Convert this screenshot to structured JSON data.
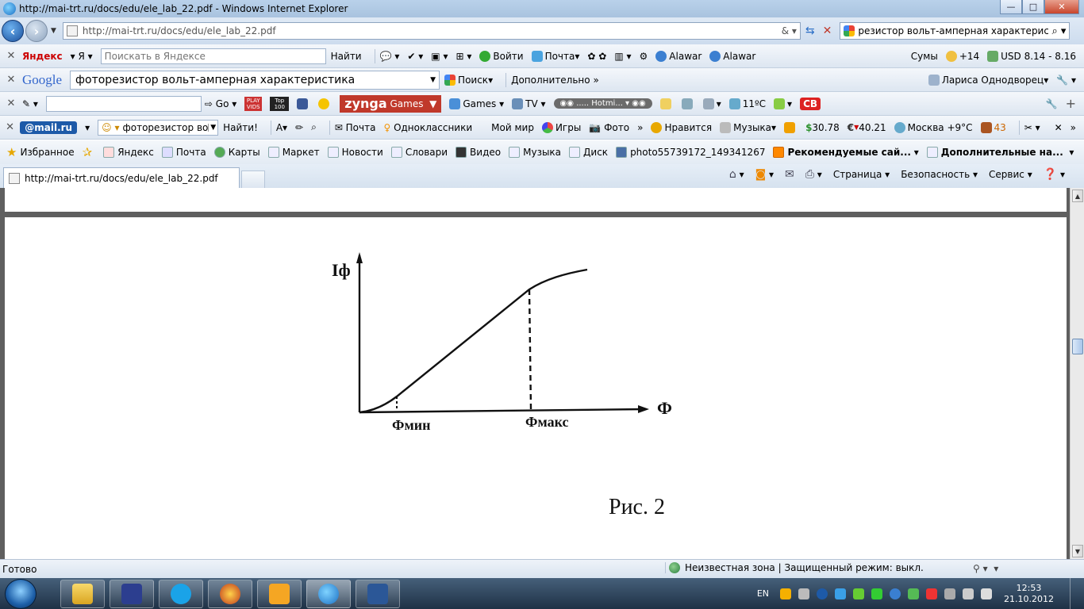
{
  "window": {
    "title": "http://mai-trt.ru/docs/edu/ele_lab_22.pdf - Windows Internet Explorer",
    "minimize": "—",
    "maximize": "□",
    "close": "✕"
  },
  "address_bar": {
    "url": "http://mai-trt.ru/docs/edu/ele_lab_22.pdf",
    "search_value": "резистор вольт-амперная характеристика"
  },
  "yandex_bar": {
    "brand": "Яндекс",
    "search_placeholder": "Поискать в Яндексе",
    "find": "Найти",
    "login": "Войти",
    "mail": "Почта",
    "alawar1": "Alawar",
    "alawar2": "Alawar",
    "sums": "Сумы",
    "temp": "+14",
    "usd": "USD 8.14 - 8.16"
  },
  "google_bar": {
    "brand": "Google",
    "query": "фоторезистор вольт-амперная характеристика",
    "search": "Поиск",
    "more": "Дополнительно",
    "user": "Лариса Однодворец"
  },
  "toolbar3": {
    "go": "Go",
    "games_brand": "zynga",
    "games": "Games",
    "games2": "Games",
    "tv": "TV",
    "hotmail": "..... Hotmi...",
    "weather": "11ºC",
    "cb": "CB",
    "play": "PLAY VIDS",
    "top": "Top 100"
  },
  "mail_bar": {
    "brand": "@mail.ru",
    "query": "фоторезистор вольт",
    "find": "Найти!",
    "mail": "Почта",
    "ok": "Одноклассники",
    "myworld": "Мой мир",
    "games": "Игры",
    "photo": "Фото",
    "like": "Нравится",
    "music": "Музыка",
    "usd": "30.78",
    "eur": "40.21",
    "weather": "Москва +9°С",
    "count": "43"
  },
  "favorites": {
    "label": "Избранное",
    "items": [
      "Яндекс",
      "Почта",
      "Карты",
      "Маркет",
      "Новости",
      "Словари",
      "Видео",
      "Музыка",
      "Диск",
      "photo55739172_149341267"
    ],
    "recommended": "Рекомендуемые сай...",
    "additional": "Дополнительные на..."
  },
  "tabs": {
    "active": "http://mai-trt.ru/docs/edu/ele_lab_22.pdf"
  },
  "commandbar": {
    "page": "Страница",
    "security": "Безопасность",
    "service": "Сервис"
  },
  "figure": {
    "y_axis_label": "Iф",
    "x_axis_label": "Ф",
    "x_min_label": "Фмин",
    "x_max_label": "Фмакс",
    "caption": "Рис. 2"
  },
  "status": {
    "left": "Готово",
    "zone": "Неизвестная зона | Защищенный режим: выкл."
  },
  "taskbar": {
    "lang": "EN",
    "time": "12:53",
    "date": "21.10.2012"
  }
}
